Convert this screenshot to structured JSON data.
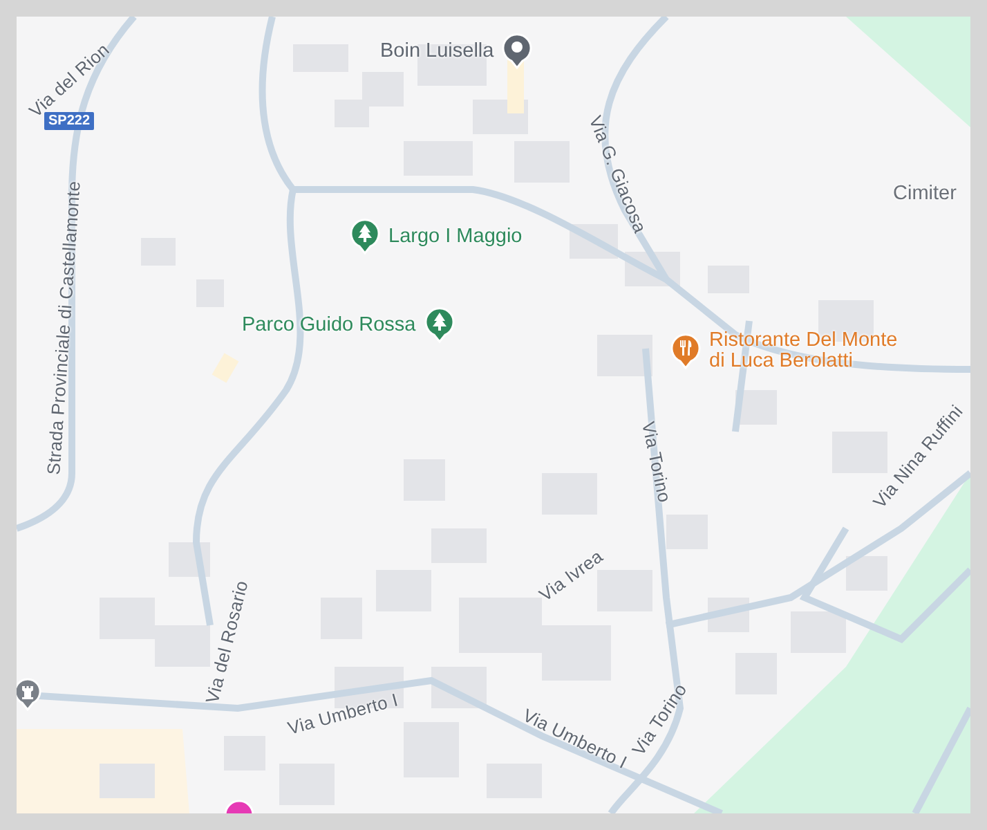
{
  "map": {
    "road_badge": "SP222",
    "places": [
      {
        "name": "Boin Luisella",
        "kind": "landmark"
      },
      {
        "name": "Largo I Maggio",
        "kind": "park"
      },
      {
        "name": "Parco Guido Rossa",
        "kind": "park"
      },
      {
        "name": "Ristorante Del Monte\ndi Luca Berolatti",
        "kind": "restaurant"
      },
      {
        "name": "Cimiter",
        "kind": "plain"
      }
    ],
    "streets": [
      "Via del Rion",
      "Strada Provinciale di Castellamonte",
      "Via G. Giacosa",
      "Via Torino",
      "Via Nina Ruffini",
      "Via Ivrea",
      "Via del Rosario",
      "Via Umberto I",
      "Via Umberto I",
      "Via Torino"
    ]
  }
}
